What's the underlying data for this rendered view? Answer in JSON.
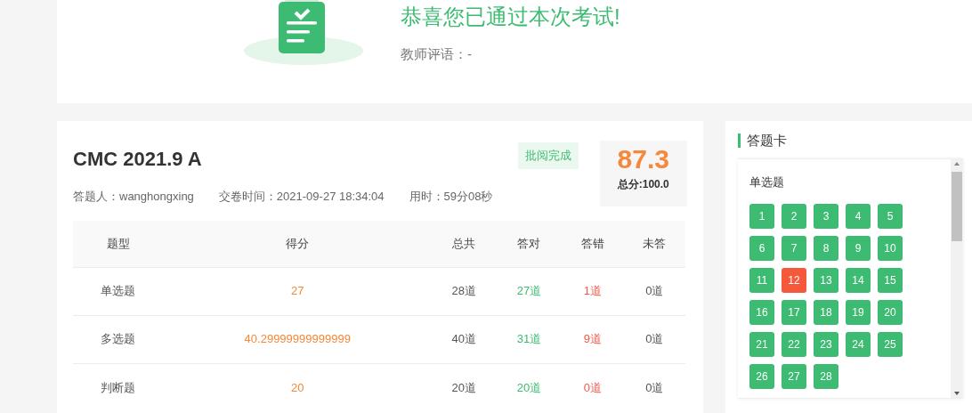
{
  "result": {
    "headline": "恭喜您已通过本次考试!",
    "comment_label": "教师评语：-"
  },
  "exam": {
    "title": "CMC 2021.9 A",
    "status_badge": "批阅完成",
    "score": "87.3",
    "total": "总分:100.0",
    "meta": [
      "答题人：wanghongxing",
      "交卷时间：2021-09-27 18:34:04",
      "用时：59分08秒"
    ]
  },
  "table": {
    "columns": [
      "题型",
      "得分",
      "总共",
      "答对",
      "答错",
      "未答"
    ],
    "rows": [
      [
        "单选题",
        "27",
        "28道",
        "27道",
        "1道",
        "0道"
      ],
      [
        "多选题",
        "40.29999999999999",
        "40道",
        "31道",
        "9道",
        "0道"
      ],
      [
        "判断题",
        "20",
        "20道",
        "20道",
        "0道",
        "0道"
      ]
    ]
  },
  "answer_card": {
    "title": "答题卡",
    "section": "单选题",
    "items": [
      {
        "label": "1",
        "correct": true
      },
      {
        "label": "2",
        "correct": true
      },
      {
        "label": "3",
        "correct": true
      },
      {
        "label": "4",
        "correct": true
      },
      {
        "label": "5",
        "correct": true
      },
      {
        "label": "6",
        "correct": true
      },
      {
        "label": "7",
        "correct": true
      },
      {
        "label": "8",
        "correct": true
      },
      {
        "label": "9",
        "correct": true
      },
      {
        "label": "10",
        "correct": true
      },
      {
        "label": "11",
        "correct": true
      },
      {
        "label": "12",
        "correct": false
      },
      {
        "label": "13",
        "correct": true
      },
      {
        "label": "14",
        "correct": true
      },
      {
        "label": "15",
        "correct": true
      },
      {
        "label": "16",
        "correct": true
      },
      {
        "label": "17",
        "correct": true
      },
      {
        "label": "18",
        "correct": true
      },
      {
        "label": "19",
        "correct": true
      },
      {
        "label": "20",
        "correct": true
      },
      {
        "label": "21",
        "correct": true
      },
      {
        "label": "22",
        "correct": true
      },
      {
        "label": "23",
        "correct": true
      },
      {
        "label": "24",
        "correct": true
      },
      {
        "label": "25",
        "correct": true
      },
      {
        "label": "26",
        "correct": true
      },
      {
        "label": "27",
        "correct": true
      },
      {
        "label": "28",
        "correct": true
      }
    ]
  }
}
